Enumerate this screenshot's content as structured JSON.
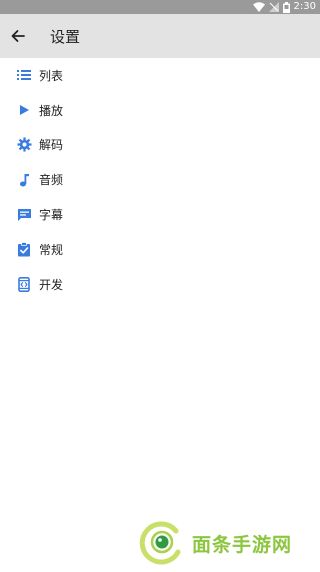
{
  "status_bar": {
    "time": "2:30"
  },
  "app_bar": {
    "back_icon": "arrow-back-icon",
    "title": "设置"
  },
  "menu": {
    "items": [
      {
        "label": "列表",
        "icon": "list-icon"
      },
      {
        "label": "播放",
        "icon": "play-icon"
      },
      {
        "label": "解码",
        "icon": "gear-icon"
      },
      {
        "label": "音频",
        "icon": "music-note-icon"
      },
      {
        "label": "字幕",
        "icon": "subtitle-icon"
      },
      {
        "label": "常规",
        "icon": "clipboard-check-icon"
      },
      {
        "label": "开发",
        "icon": "developer-icon"
      }
    ]
  },
  "watermark": {
    "text": "面条手游网"
  },
  "colors": {
    "accent": "#3a7be0",
    "status_bar": "#9a9a9a",
    "app_bar": "#e3e3e3",
    "watermark": "#8cc63e"
  }
}
